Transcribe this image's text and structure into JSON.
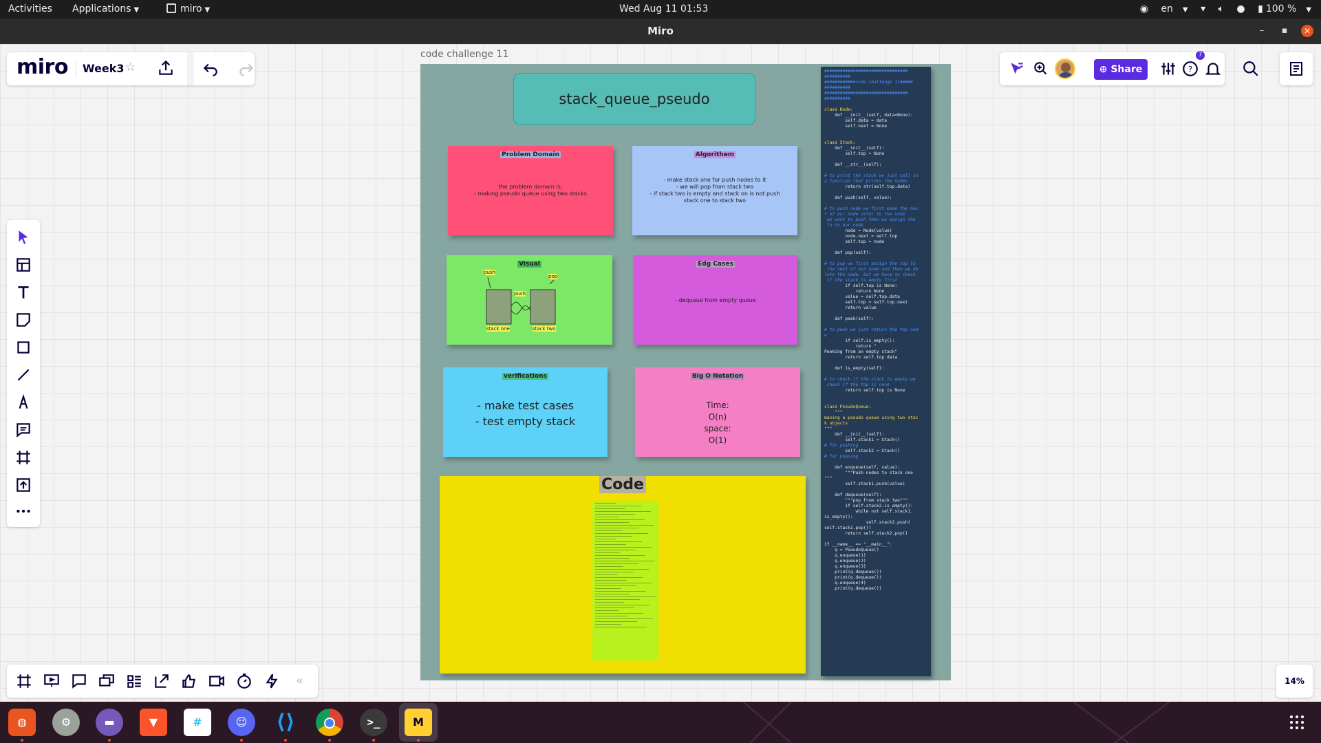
{
  "topbar": {
    "activities": "Activities",
    "applications": "Applications",
    "app_name": "miro",
    "clock": "Wed Aug 11  01:53",
    "language": "en",
    "battery": "100 %"
  },
  "window": {
    "title": "Miro"
  },
  "board": {
    "logo": "miro",
    "name": "Week3",
    "share_label": "Share",
    "help_badge": "7",
    "zoom": "14%"
  },
  "frame": {
    "label": "code challenge 11",
    "title": "stack_queue_pseudo",
    "problem": {
      "header": "Problem Domain",
      "line1": "the problem domain is:",
      "line2": "- making pseudo queue using two stacks"
    },
    "algorithm": {
      "header": "Algorithem",
      "line1": "- make stack one for push nodes to it",
      "line2": "- we will pop from stack two",
      "line3": "- if stack two is empty and stack on is not push stack one to stack two"
    },
    "visual": {
      "header": "Visual",
      "push1": "push",
      "pop": "pop",
      "push2": "push",
      "stack_one": "stack one",
      "stack_two": "stack two"
    },
    "edge": {
      "header": "Edg Cases",
      "line1": "- dequeue from empty queue"
    },
    "verifications": {
      "header": "verifications",
      "line1": "- make test cases",
      "line2": "- test empty stack"
    },
    "bigo": {
      "header": "Big O Notation",
      "line1": "Time:",
      "line2": "O(n)",
      "line3": "space:",
      "line4": "O(1)"
    },
    "code": {
      "header": "Code"
    }
  },
  "code_lines": [
    {
      "t": "################################",
      "c": "cm"
    },
    {
      "t": "##########",
      "c": "cm"
    },
    {
      "t": "############code challenge 11#####",
      "c": "cm"
    },
    {
      "t": "##########",
      "c": "cm"
    },
    {
      "t": "################################",
      "c": "cm"
    },
    {
      "t": "##########",
      "c": "cm"
    },
    {
      "t": "",
      "c": "gap"
    },
    {
      "t": "class Node:",
      "c": "kw"
    },
    {
      "t": "    def __init__(self, data=None):",
      "c": ""
    },
    {
      "t": "        self.data = data",
      "c": ""
    },
    {
      "t": "        self.next = None",
      "c": ""
    },
    {
      "t": "",
      "c": "gap"
    },
    {
      "t": "",
      "c": "gap"
    },
    {
      "t": "class Stack:",
      "c": "kw"
    },
    {
      "t": "    def __init__(self):",
      "c": ""
    },
    {
      "t": "        self.top = None",
      "c": ""
    },
    {
      "t": "",
      "c": "gap"
    },
    {
      "t": "    def __str__(self):",
      "c": ""
    },
    {
      "t": "",
      "c": "gap"
    },
    {
      "t": "# to print the stack we just call in",
      "c": "cm"
    },
    {
      "t": "a function that prints the nodes",
      "c": "cm"
    },
    {
      "t": "        return str(self.top.data)",
      "c": ""
    },
    {
      "t": "",
      "c": "gap"
    },
    {
      "t": "    def push(self, value):",
      "c": ""
    },
    {
      "t": "",
      "c": "gap"
    },
    {
      "t": "# to push node we first make the nex",
      "c": "cm"
    },
    {
      "t": "t of our node refer to the node",
      "c": "cm"
    },
    {
      "t": " we want to push then we assign the",
      "c": "cm"
    },
    {
      "t": " to to our node",
      "c": "cm"
    },
    {
      "t": "        node = Node(value)",
      "c": ""
    },
    {
      "t": "        node.next = self.top",
      "c": ""
    },
    {
      "t": "        self.top = node",
      "c": ""
    },
    {
      "t": "",
      "c": "gap"
    },
    {
      "t": "    def pop(self):",
      "c": ""
    },
    {
      "t": "",
      "c": "gap"
    },
    {
      "t": "# to pop we first assign the top to",
      "c": "cm"
    },
    {
      "t": " the next of our node and then we de",
      "c": "cm"
    },
    {
      "t": "lete the node, but we have to check",
      "c": "cm"
    },
    {
      "t": " if the stack is empty first",
      "c": "cm"
    },
    {
      "t": "        if self.top is None:",
      "c": ""
    },
    {
      "t": "            return None",
      "c": ""
    },
    {
      "t": "        value = self.top.data",
      "c": ""
    },
    {
      "t": "        self.top = self.top.next",
      "c": ""
    },
    {
      "t": "        return value",
      "c": ""
    },
    {
      "t": "",
      "c": "gap"
    },
    {
      "t": "    def peek(self):",
      "c": ""
    },
    {
      "t": "",
      "c": "gap"
    },
    {
      "t": "# to peek we just return the top nod",
      "c": "cm"
    },
    {
      "t": "e",
      "c": "cm"
    },
    {
      "t": "        if self.is_empty():",
      "c": ""
    },
    {
      "t": "            return \"",
      "c": ""
    },
    {
      "t": "Peeking from an empty stack\"",
      "c": ""
    },
    {
      "t": "        return self.top.data",
      "c": ""
    },
    {
      "t": "",
      "c": "gap"
    },
    {
      "t": "    def is_empty(self):",
      "c": ""
    },
    {
      "t": "",
      "c": "gap"
    },
    {
      "t": "# to check if the stack is empty we",
      "c": "cm"
    },
    {
      "t": " check if the top is none",
      "c": "cm"
    },
    {
      "t": "        return self.top is None",
      "c": ""
    },
    {
      "t": "",
      "c": "gap"
    },
    {
      "t": "",
      "c": "gap"
    },
    {
      "t": "class PseudoQueue:",
      "c": "kw"
    },
    {
      "t": "    \"\"\"",
      "c": ""
    },
    {
      "t": "making a pseudo queue using two stac",
      "c": "kw"
    },
    {
      "t": "k objects",
      "c": "kw"
    },
    {
      "t": "\"\"\"",
      "c": ""
    },
    {
      "t": "    def __init__(self):",
      "c": ""
    },
    {
      "t": "        self.stack1 = Stack()",
      "c": ""
    },
    {
      "t": "# for pushing",
      "c": "cm"
    },
    {
      "t": "        self.stack2 = Stack()",
      "c": ""
    },
    {
      "t": "# for popping",
      "c": "cm"
    },
    {
      "t": "",
      "c": "gap"
    },
    {
      "t": "    def enqueue(self, value):",
      "c": ""
    },
    {
      "t": "        \"\"\"Push nodes to stack one",
      "c": ""
    },
    {
      "t": "\"\"\"",
      "c": ""
    },
    {
      "t": "        self.stack1.push(value)",
      "c": ""
    },
    {
      "t": "",
      "c": "gap"
    },
    {
      "t": "    def dequeue(self):",
      "c": ""
    },
    {
      "t": "        \"\"\"pop from stack two\"\"\"",
      "c": ""
    },
    {
      "t": "        if self.stack2.is_empty():",
      "c": ""
    },
    {
      "t": "            while not self.stack1.",
      "c": ""
    },
    {
      "t": "is_empty():",
      "c": ""
    },
    {
      "t": "                self.stack2.push(",
      "c": ""
    },
    {
      "t": "self.stack1.pop())",
      "c": ""
    },
    {
      "t": "        return self.stack2.pop()",
      "c": ""
    },
    {
      "t": "",
      "c": "gap"
    },
    {
      "t": "if __name__ == \"__main__\":",
      "c": ""
    },
    {
      "t": "    q = PseudoQueue()",
      "c": ""
    },
    {
      "t": "    q.enqueue(1)",
      "c": ""
    },
    {
      "t": "    q.enqueue(2)",
      "c": ""
    },
    {
      "t": "    q.enqueue(3)",
      "c": ""
    },
    {
      "t": "    print(q.dequeue())",
      "c": ""
    },
    {
      "t": "    print(q.dequeue())",
      "c": ""
    },
    {
      "t": "    q.enqueue(4)",
      "c": ""
    },
    {
      "t": "    print(q.dequeue())",
      "c": ""
    }
  ]
}
